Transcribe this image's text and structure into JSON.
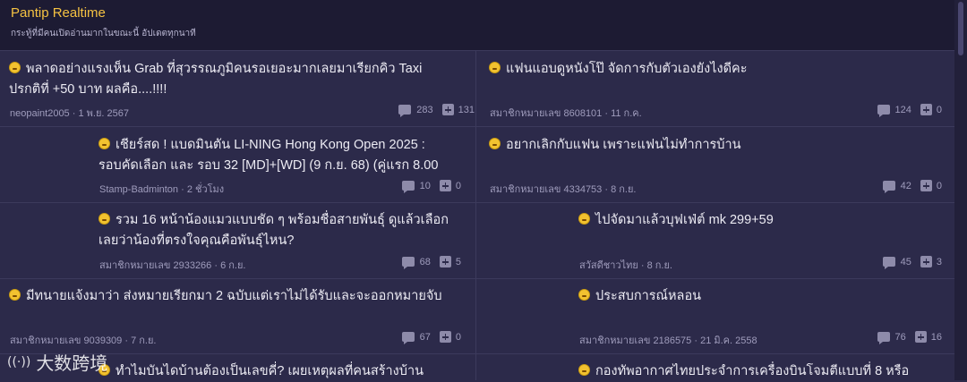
{
  "header": {
    "title": "Pantip Realtime",
    "subtitle": "กระทู้ที่มีคนเปิดอ่านมากในขณะนี้ อัปเดตทุกนาที"
  },
  "topics": [
    {
      "title_line1": "พลาดอย่างแรงเห็น Grab ที่สุวรรณภูมิคนรอเยอะมากเลยมาเรียกคิว Taxi",
      "title_line2": "ปรกติที่ +50 บาท ผลคือ....!!!!",
      "author": "neopaint2005",
      "date": "1 พ.ย. 2567",
      "comments": "283",
      "votes": "131"
    },
    {
      "title_line1": "แฟนแอบดูหนังโป๊ จัดการกับตัวเองยังไงดีคะ",
      "title_line2": "",
      "author": "สมาชิกหมายเลข 8608101",
      "date": "11 ก.ค.",
      "comments": "124",
      "votes": "0"
    },
    {
      "title_line1": "เชียร์สด ! แบดมินตัน LI-NING Hong Kong Open 2025 :",
      "title_line2": "รอบคัดเลือก และ รอบ 32 [MD]+[WD] (9 ก.ย. 68) (คู่แรก 8.00",
      "author": "Stamp-Badminton",
      "date": "2 ชั่วโมง",
      "comments": "10",
      "votes": "0"
    },
    {
      "title_line1": "อยากเลิกกับแฟน เพราะแฟนไม่ทำการบ้าน",
      "title_line2": "",
      "author": "สมาชิกหมายเลข 4334753",
      "date": "8 ก.ย.",
      "comments": "42",
      "votes": "0"
    },
    {
      "title_line1": "รวม 16 หน้าน้องแมวแบบชัด ๆ พร้อมชื่อสายพันธุ์ ดูแล้วเลือก",
      "title_line2": "เลยว่าน้องที่ตรงใจคุณคือพันธุ์ไหน?",
      "author": "สมาชิกหมายเลข 2933266",
      "date": "6 ก.ย.",
      "comments": "68",
      "votes": "5"
    },
    {
      "title_line1": "ไปจัดมาแล้วบุฟเฟ่ต์ mk 299+59",
      "title_line2": "",
      "author": "สวัสดีชาวไทย",
      "date": "8 ก.ย.",
      "comments": "45",
      "votes": "3"
    },
    {
      "title_line1": "มีทนายแจ้งมาว่า ส่งหมายเรียกมา 2 ฉบับแต่เราไม่ได้รับและจะออกหมายจับ",
      "title_line2": "",
      "author": "สมาชิกหมายเลข 9039309",
      "date": "7 ก.ย.",
      "comments": "67",
      "votes": "0"
    },
    {
      "title_line1": "ประสบการณ์หลอน",
      "title_line2": "",
      "author": "สมาชิกหมายเลข 2186575",
      "date": "21 มิ.ค. 2558",
      "comments": "76",
      "votes": "16"
    },
    {
      "title_line1": "ทำไมบันไดบ้านต้องเป็นเลขคี่? เผยเหตุผลที่คนสร้างบ้าน",
      "title_line2": "",
      "author": "",
      "date": "",
      "comments": "",
      "votes": ""
    },
    {
      "title_line1": "กองทัพอากาศไทยประจำการเครื่องบินโจมตีแบบที่ 8 หรือ",
      "title_line2": "",
      "author": "",
      "date": "",
      "comments": "",
      "votes": ""
    }
  ],
  "watermark": "大数跨境",
  "watermark_logo": "((·))"
}
